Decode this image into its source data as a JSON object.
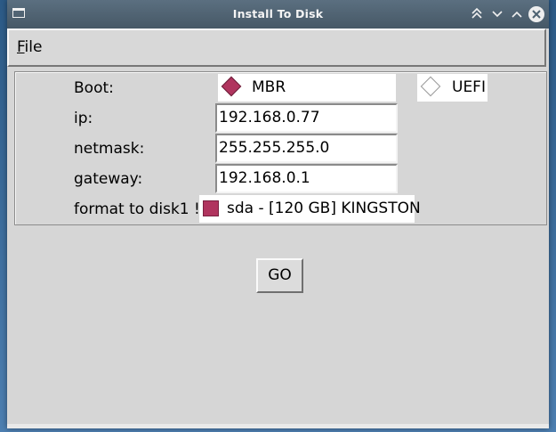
{
  "window": {
    "title": "Install To Disk"
  },
  "menu": {
    "file": {
      "first_letter": "F",
      "rest": "ile"
    }
  },
  "form": {
    "boot": {
      "label": "Boot:",
      "options": [
        {
          "label": "MBR",
          "selected": true
        },
        {
          "label": "UEFI",
          "selected": false
        }
      ]
    },
    "ip": {
      "label": "ip:",
      "value": "192.168.0.77"
    },
    "netmask": {
      "label": "netmask:",
      "value": "255.255.255.0"
    },
    "gateway": {
      "label": "gateway:",
      "value": "192.168.0.1"
    },
    "format": {
      "label": "format to disk1 !",
      "option_label": "sda - [120 GB] KINGSTON",
      "checked": true
    }
  },
  "actions": {
    "go_label": "GO"
  },
  "icons": {
    "window_menu": "window-menu-icon",
    "keep_above": "keep-above-icon",
    "minimize": "minimize-icon",
    "maximize": "maximize-icon",
    "close": "close-icon"
  },
  "colors": {
    "titlebar": "#4e6272",
    "window_bg": "#d6d6d6",
    "accent": "#b0345e"
  }
}
